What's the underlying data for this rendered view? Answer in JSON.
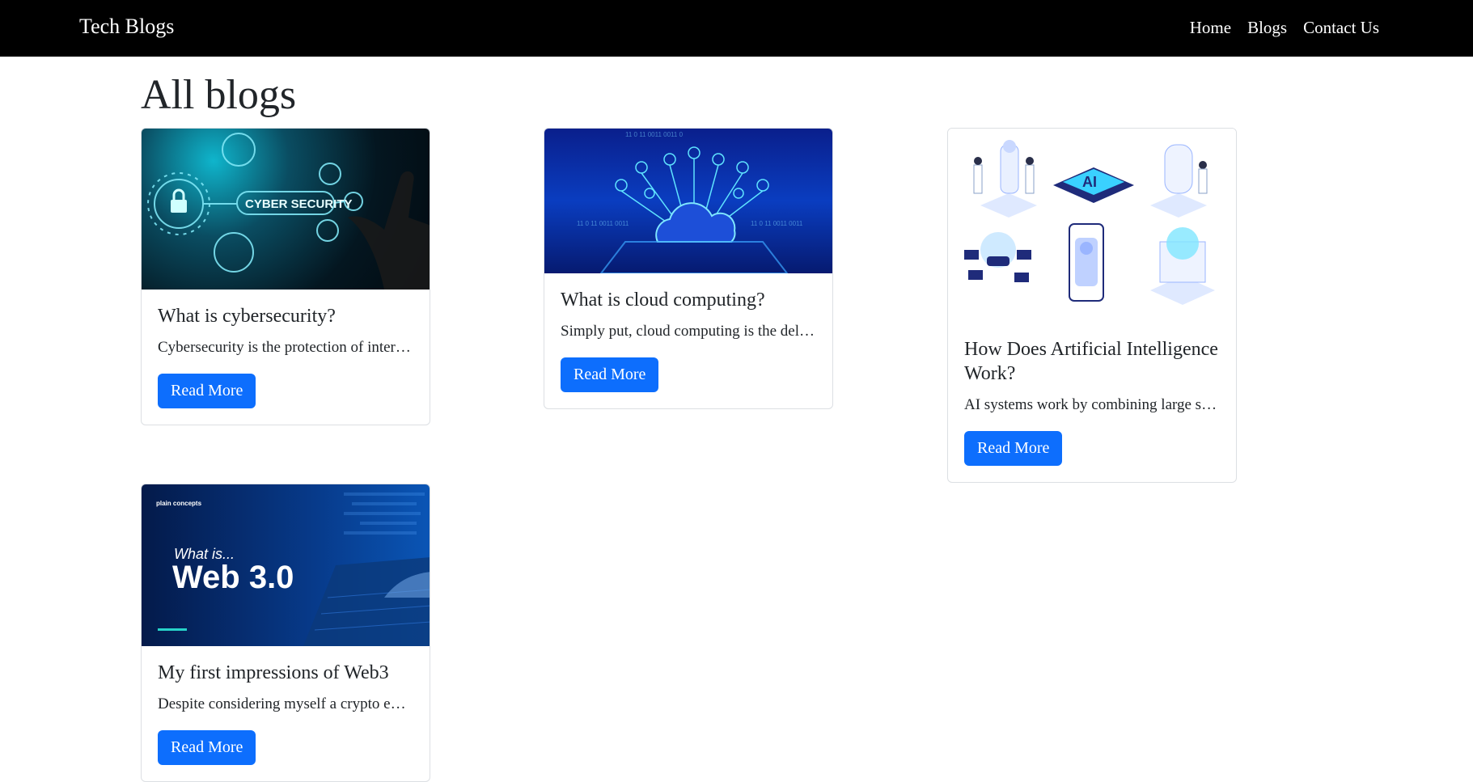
{
  "navbar": {
    "brand": "Tech Blogs",
    "links": [
      "Home",
      "Blogs",
      "Contact Us"
    ]
  },
  "page": {
    "title": "All blogs"
  },
  "colors": {
    "navbar_bg": "#000000",
    "button_bg": "#0d6efd",
    "button_text": "#ffffff"
  },
  "cards": [
    {
      "title": "What is cybersecurity?",
      "excerpt": "Cybersecurity is the protection of internet-connected systems",
      "button": "Read More",
      "image_icon": "cybersecurity-image",
      "image_text": "CYBER SECURITY"
    },
    {
      "title": "What is cloud computing?",
      "excerpt": "Simply put, cloud computing is the delivery of computing services",
      "button": "Read More",
      "image_icon": "cloud-computing-image"
    },
    {
      "title": "How Does Artificial Intelligence Work?",
      "excerpt": "AI systems work by combining large sets of data",
      "button": "Read More",
      "image_icon": "ai-isometric-image",
      "image_text": "AI"
    },
    {
      "title": "My first impressions of Web3",
      "excerpt": "Despite considering myself a crypto enthusiast",
      "button": "Read More",
      "image_icon": "web3-image",
      "image_text_small": "What is...",
      "image_text_large": "Web 3.0",
      "image_logo": "plain concepts"
    }
  ]
}
